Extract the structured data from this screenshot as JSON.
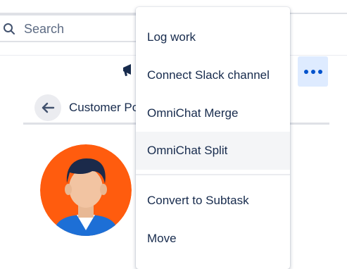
{
  "search": {
    "placeholder": "Search",
    "icon": "search-icon"
  },
  "toolbar": {
    "feedback_icon": "megaphone-icon",
    "more_icon": "more-horizontal-icon",
    "accent": "#0052cc",
    "more_bg": "#deebff"
  },
  "breadcrumb": {
    "back_icon": "arrow-left-icon",
    "label": "Customer Portal"
  },
  "avatar": {
    "bg": "#ff5c0e"
  },
  "menu": {
    "items": [
      {
        "label": "Log work"
      },
      {
        "label": "Connect Slack channel"
      },
      {
        "label": "OmniChat Merge"
      },
      {
        "label": "OmniChat Split",
        "highlighted": true
      },
      {
        "label": "Convert to Subtask"
      },
      {
        "label": "Move"
      }
    ]
  }
}
